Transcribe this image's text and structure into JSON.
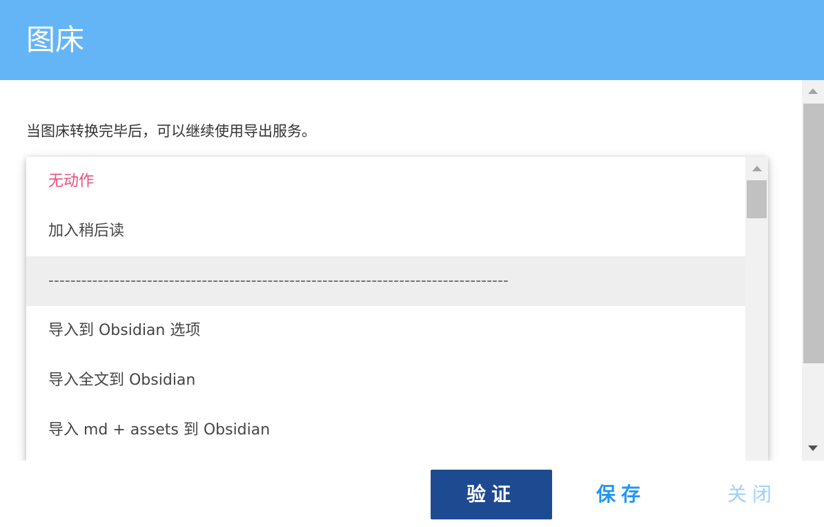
{
  "dialog": {
    "title": "图床"
  },
  "content": {
    "description": "当图床转换完毕后，可以继续使用导出服务。"
  },
  "dropdown": {
    "options": [
      {
        "label": "无动作",
        "state": "selected"
      },
      {
        "label": "加入稍后读",
        "state": "normal"
      },
      {
        "label": "------------------------------------------------------------------------------------",
        "state": "highlighted"
      },
      {
        "label": "导入到 Obsidian 选项",
        "state": "normal"
      },
      {
        "label": "导入全文到 Obsidian",
        "state": "normal"
      },
      {
        "label": "导入 md + assets 到 Obsidian",
        "state": "normal"
      }
    ]
  },
  "buttons": {
    "verify": "验证",
    "save": "保存",
    "close": "关闭"
  },
  "colors": {
    "header_bg": "#64b5f6",
    "selected_option": "#e84c7d",
    "verify_bg": "#1e4a91",
    "save_text": "#2196f3",
    "close_text": "#9fd0f7"
  }
}
